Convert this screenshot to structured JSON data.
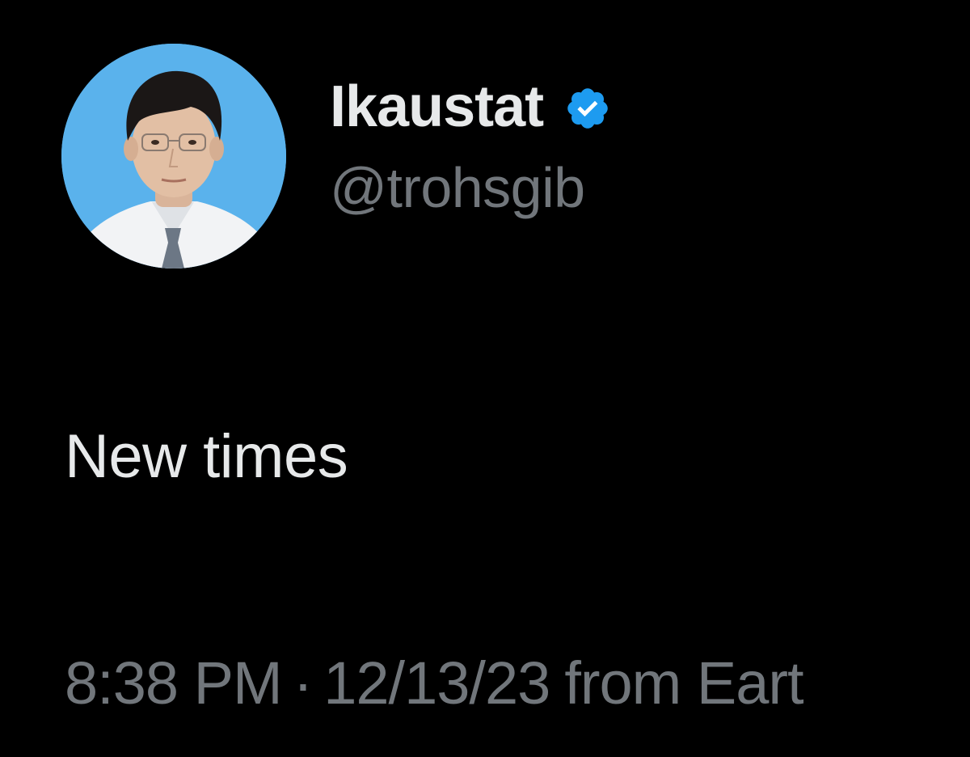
{
  "tweet": {
    "display_name": "Ikaustat",
    "handle": "@trohsgib",
    "verified": true,
    "verified_icon": "verified-badge-icon",
    "text": "New times",
    "time": "8:38 PM",
    "separator": "·",
    "date": "12/13/23",
    "source": "from Eart"
  },
  "colors": {
    "background": "#000000",
    "primary_text": "#e7e9ea",
    "secondary_text": "#71767b",
    "verified_blue": "#1d9bf0",
    "avatar_background": "#5ab2ec"
  }
}
